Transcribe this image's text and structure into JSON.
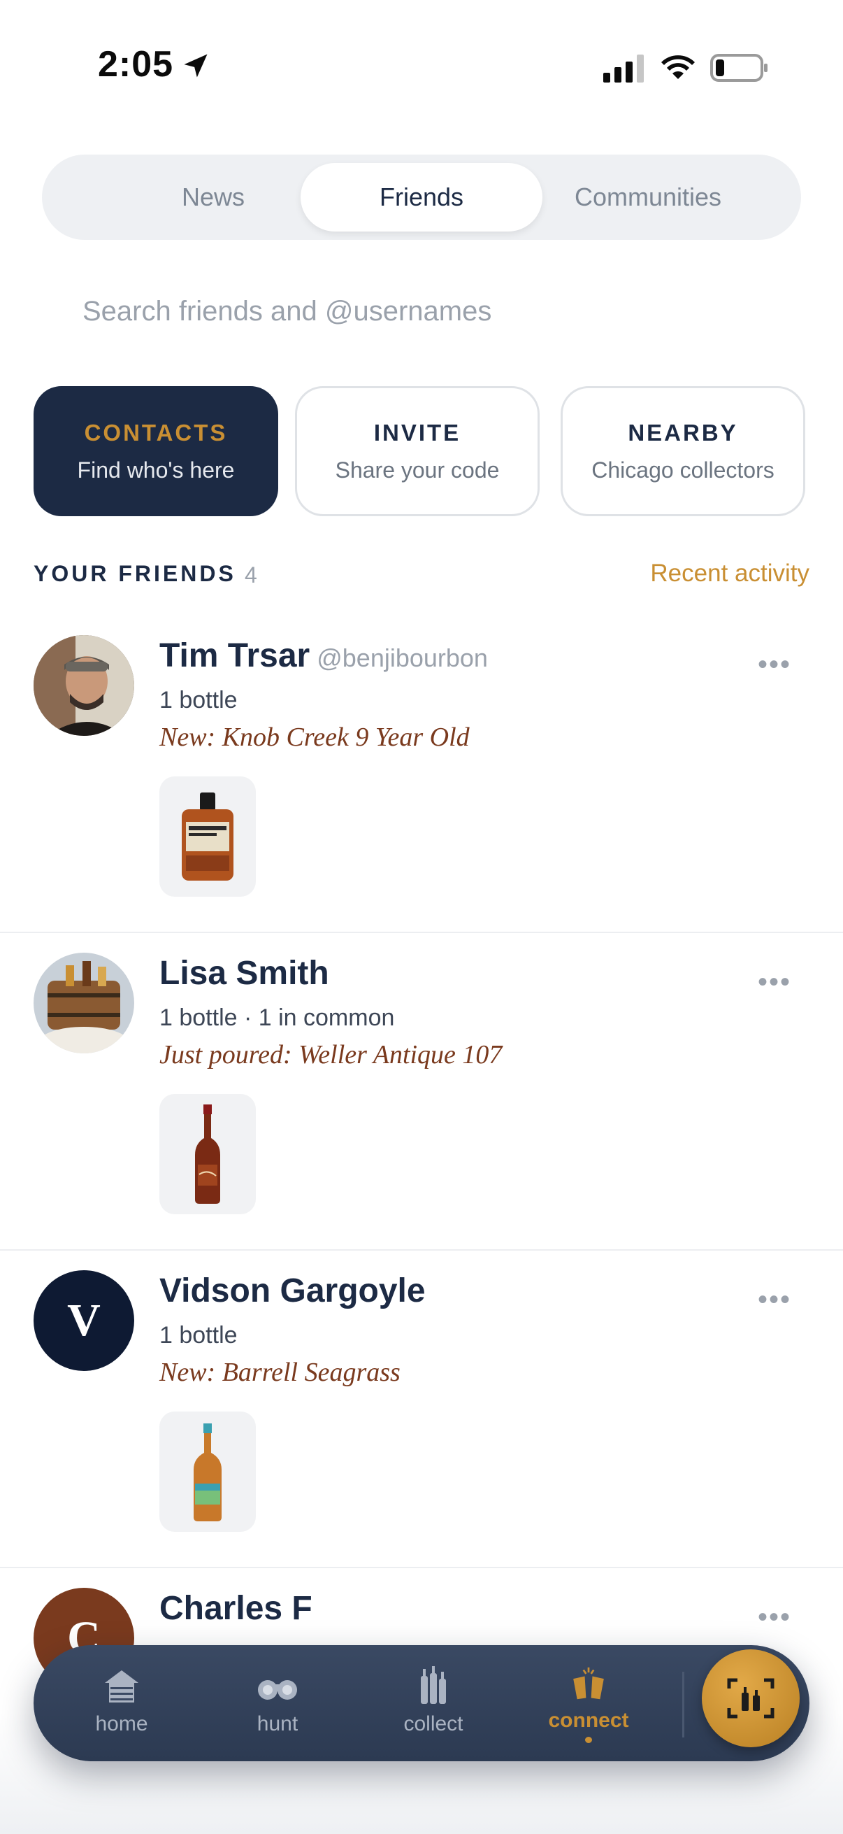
{
  "status_bar": {
    "time": "2:05"
  },
  "tabs": {
    "news": "News",
    "friends": "Friends",
    "communities": "Communities"
  },
  "search": {
    "placeholder": "Search friends and @usernames"
  },
  "cards": {
    "contacts": {
      "title": "CONTACTS",
      "subtitle": "Find who's here"
    },
    "invite": {
      "title": "INVITE",
      "subtitle": "Share your code"
    },
    "nearby": {
      "title": "NEARBY",
      "subtitle": "Chicago collectors"
    }
  },
  "friends_section": {
    "title": "YOUR FRIENDS",
    "count": "4",
    "recent_link": "Recent activity"
  },
  "friends": [
    {
      "name": "Tim Trsar",
      "handle": "@benjibourbon",
      "bottles": "1 bottle",
      "activity": "New: Knob Creek 9 Year Old",
      "more": "•••"
    },
    {
      "name": "Lisa Smith",
      "handle": "",
      "bottles": "1 bottle · 1 in common",
      "activity": "Just poured: Weller Antique 107",
      "more": "•••"
    },
    {
      "name": "Vidson Gargoyle",
      "handle": "",
      "bottles": "1 bottle",
      "activity": "New: Barrell Seagrass",
      "avatar_letter": "V",
      "avatar_color": "#0e1a33",
      "more": "•••"
    },
    {
      "name": "Charles F",
      "avatar_letter": "C",
      "avatar_color": "#7a3a1e",
      "more": "•••"
    }
  ],
  "bottom_nav": {
    "home": "home",
    "hunt": "hunt",
    "collect": "collect",
    "connect": "connect"
  },
  "colors": {
    "accent": "#c98f33",
    "navy": "#1c2a44",
    "activity": "#7a3a1e"
  }
}
